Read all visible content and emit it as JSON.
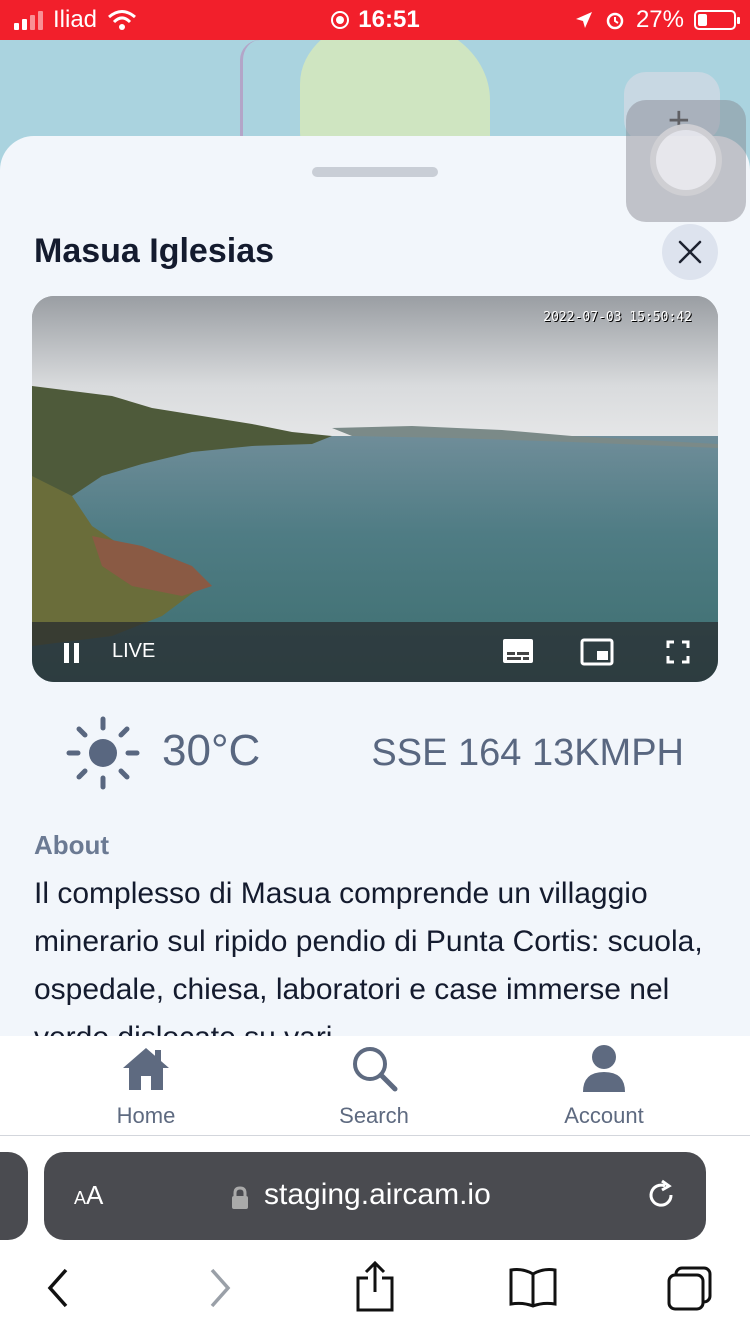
{
  "status_bar": {
    "carrier": "Iliad",
    "time": "16:51",
    "battery": "27%",
    "icons": [
      "signal-icon",
      "wifi-icon",
      "screen-record-icon",
      "location-icon",
      "alarm-icon",
      "battery-icon"
    ]
  },
  "map": {
    "zoom_in_label": "+"
  },
  "sheet": {
    "title": "Masua Iglesias",
    "close_icon": "close-icon"
  },
  "video": {
    "timestamp": "2022-07-03 15:50:42",
    "live_label": "LIVE",
    "controls": [
      "pause-icon",
      "subtitles-icon",
      "picture-in-picture-icon",
      "fullscreen-icon"
    ]
  },
  "weather": {
    "icon": "sun-icon",
    "temperature": "30°C",
    "wind": "SSE 164 13KMPH"
  },
  "about": {
    "label": "About",
    "text": "Il complesso di Masua comprende un villaggio minerario sul ripido pendio di Punta Cortis: scuola, ospedale, chiesa, laboratori e case immerse nel verde dislocate su vari"
  },
  "tabs": [
    {
      "label": "Home",
      "icon": "home-icon"
    },
    {
      "label": "Search",
      "icon": "search-icon"
    },
    {
      "label": "Account",
      "icon": "account-icon"
    }
  ],
  "safari": {
    "aa_label_small": "A",
    "aa_label_large": "A",
    "url": "staging.aircam.io",
    "toolbar": [
      "back-icon",
      "forward-icon",
      "share-icon",
      "bookmarks-icon",
      "tabs-icon"
    ]
  },
  "colors": {
    "status_bar": "#f21f2b",
    "sheet_bg": "#f2f6fb",
    "muted_text": "#596780",
    "title_text": "#141b2e"
  }
}
